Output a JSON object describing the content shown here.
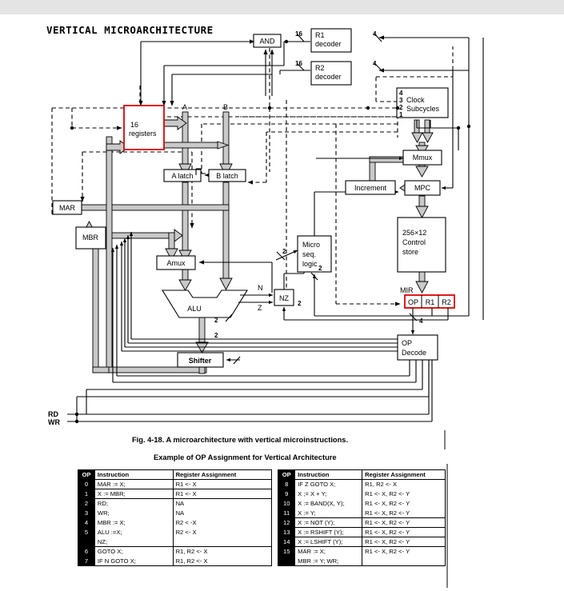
{
  "page": {
    "title": "VERTICAL MICROARCHITECTURE",
    "figure_caption": "Fig. 4-18. A microarchitecture with vertical microinstructions.",
    "table_title": "Example of OP Assignment for Vertical Architecture",
    "accent_color": "#e00000",
    "bus_color": "#c9c9c9",
    "background": "#ffffff",
    "top_band_color": "#e4e4e4"
  },
  "diagram": {
    "blocks": {
      "and_gate": "AND",
      "r1_decoder_line1": "R1",
      "r1_decoder_line2": "decoder",
      "r2_decoder_line1": "R2",
      "r2_decoder_line2": "decoder",
      "clock_label_line1": "Clock",
      "clock_label_line2": "Subcycles",
      "clock_ticks": [
        "4",
        "3",
        "2",
        "1"
      ],
      "registers_line1": "16",
      "registers_line2": "registers",
      "a_latch": "A latch",
      "b_latch": "B latch",
      "bus_a": "A",
      "bus_b": "B",
      "mar": "MAR",
      "mbr": "MBR",
      "amux": "Amux",
      "alu": "ALU",
      "shifter": "Shifter",
      "nz": "NZ",
      "micro_seq_line1": "Micro",
      "micro_seq_line2": "seq.",
      "micro_seq_line3": "logic",
      "mmux": "Mmux",
      "increment": "Increment",
      "mpc": "MPC",
      "control_store_line1": "256×12",
      "control_store_line2": "Control",
      "control_store_line3": "store",
      "mir_label": "MIR",
      "mir_fields": [
        "OP",
        "R1",
        "R2"
      ],
      "op_decode_line1": "OP",
      "op_decode_line2": "Decode",
      "rd": "RD",
      "wr": "WR"
    },
    "wire_labels": {
      "and_to_r1_width": "16",
      "r1_decoder_in_width": "4",
      "and_to_r2_width": "16",
      "r2_decoder_in_width": "4",
      "alu_flag_n": "N",
      "alu_flag_z": "Z",
      "alu_func_width": "2",
      "shifter_func_width": "2",
      "nz_to_seq_width": "2",
      "seq_in_width": "2",
      "mir_op_width": "4"
    }
  },
  "op_table": {
    "headers": [
      "OP",
      "Instruction",
      "Register Assignment"
    ],
    "left_rows": [
      {
        "op": "0",
        "instruction": "MAR := X;",
        "register": "R1 <- X",
        "group_end": true
      },
      {
        "op": "1",
        "instruction": "X := MBR;",
        "register": "R1 <- X",
        "group_end": true
      },
      {
        "op": "2",
        "instruction": "RD;",
        "register": "NA",
        "group_end": false
      },
      {
        "op": "3",
        "instruction": "WR;",
        "register": "NA",
        "group_end": false
      },
      {
        "op": "4",
        "instruction": "MBR := X;",
        "register": "R2 < -X",
        "group_end": false
      },
      {
        "op": "5",
        "instruction": "ALU :=X;",
        "register": "R2 <- X",
        "group_end": false
      },
      {
        "op": "",
        "instruction": "NZ;",
        "register": "",
        "group_end": true
      },
      {
        "op": "6",
        "instruction": "GOTO X;",
        "register": "R1, R2 <- X",
        "group_end": false
      },
      {
        "op": "7",
        "instruction": "IF N GOTO X;",
        "register": "R1, R2 <- X",
        "group_end": true
      }
    ],
    "right_rows": [
      {
        "op": "8",
        "instruction": "IF Z GOTO X;",
        "register": "R1, R2 <- X",
        "group_end": false
      },
      {
        "op": "9",
        "instruction": "X ;= X + Y;",
        "register": "R1 <- X, R2 <- Y",
        "group_end": false
      },
      {
        "op": "10",
        "instruction": "X := BAND(X, Y);",
        "register": "R1 <- X, R2 <- Y",
        "group_end": false
      },
      {
        "op": "11",
        "instruction": "X := Y;",
        "register": "R1 <- X, R2 <- Y",
        "group_end": true
      },
      {
        "op": "12",
        "instruction": "X := NOT (Y);",
        "register": "R1 <- X, R2 <- Y",
        "group_end": true
      },
      {
        "op": "13",
        "instruction": "X := RSHIFT (Y);",
        "register": "R1 <- X, R2 <- Y",
        "group_end": true
      },
      {
        "op": "14",
        "instruction": "X := LSHIFT (Y);",
        "register": "R1 <- X, R2 <- Y",
        "group_end": true
      },
      {
        "op": "15",
        "instruction": "MAR := X;",
        "register": "R1 <- X, R2 <- Y",
        "group_end": false
      },
      {
        "op": "",
        "instruction": "MBR := Y; WR;",
        "register": "",
        "group_end": true
      }
    ]
  }
}
